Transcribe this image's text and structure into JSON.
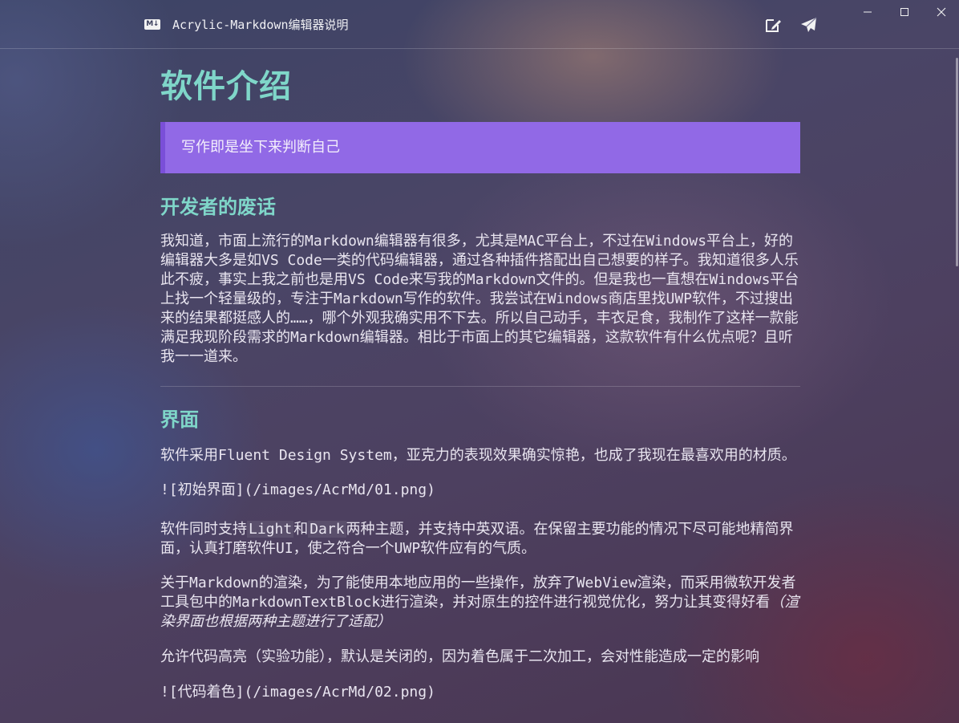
{
  "window": {
    "app_icon_text": "M↓",
    "title": "Acrylic-Markdown编辑器说明"
  },
  "toolbar": {
    "edit_icon": "edit-icon",
    "send_icon": "send-icon"
  },
  "window_controls": [
    "minimize",
    "maximize",
    "close"
  ],
  "doc": {
    "h1": "软件介绍",
    "quote": "写作即是坐下来判断自己",
    "sections": [
      {
        "heading": "开发者的废话",
        "paragraph": "我知道，市面上流行的Markdown编辑器有很多，尤其是MAC平台上，不过在Windows平台上，好的编辑器大多是如VS Code一类的代码编辑器，通过各种插件搭配出自己想要的样子。我知道很多人乐此不疲，事实上我之前也是用VS Code来写我的Markdown文件的。但是我也一直想在Windows平台上找一个轻量级的，专注于Markdown写作的软件。我尝试在Windows商店里找UWP软件，不过搜出来的结果都挺感人的……，哪个外观我确实用不下去。所以自己动手，丰衣足食，我制作了这样一款能满足我现阶段需求的Markdown编辑器。相比于市面上的其它编辑器，这款软件有什么优点呢？且听我一一道来。"
      }
    ],
    "ui_section": {
      "heading": "界面",
      "p1": "软件采用Fluent Design System，亚克力的表现效果确实惊艳，也成了我现在最喜欢用的材质。",
      "img1": "![初始界面](/images/AcrMd/01.png)",
      "p2_pre": "软件同时支持",
      "p2_code1": "Light",
      "p2_mid": "和",
      "p2_code2": "Dark",
      "p2_post": "两种主题，并支持中英双语。在保留主要功能的情况下尽可能地精简界面，认真打磨软件UI，使之符合一个UWP软件应有的气质。",
      "p3": "关于Markdown的渲染，为了能使用本地应用的一些操作，放弃了WebView渲染，而采用微软开发者工具包中的MarkdownTextBlock进行渲染，并对原生的控件进行视觉优化，努力让其变得好看",
      "p3_em": "（渲染界面也根据两种主题进行了适配）",
      "p4": "允许代码高亮（实验功能），默认是关闭的，因为着色属于二次加工，会对性能造成一定的影响",
      "img2": "![代码着色](/images/AcrMd/02.png)"
    }
  },
  "colors": {
    "heading": "#7fd6c9",
    "quote_bg": "#9169e6",
    "quote_border": "#7a4fd8"
  }
}
